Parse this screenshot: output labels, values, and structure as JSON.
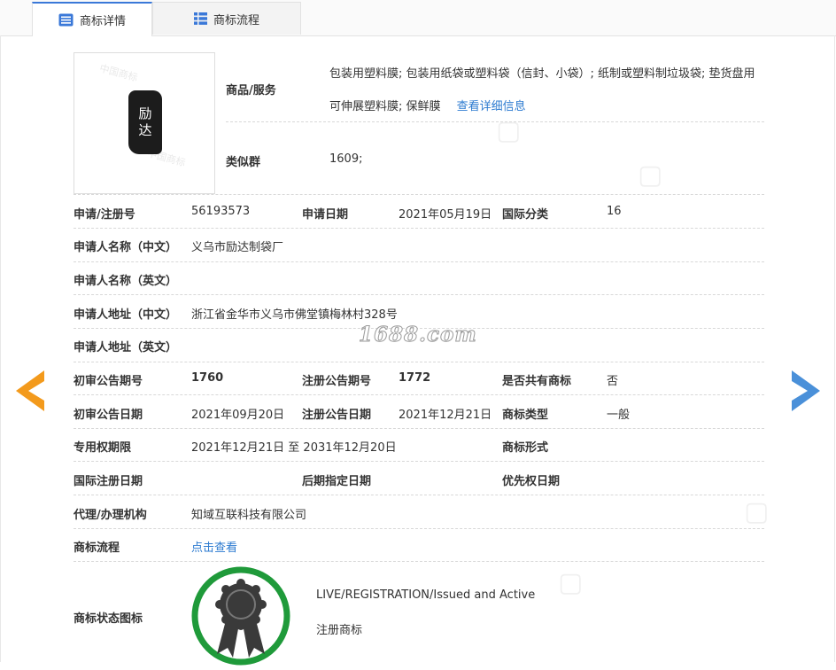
{
  "tabs": [
    {
      "label": "商标详情",
      "active": true
    },
    {
      "label": "商标流程",
      "active": false
    }
  ],
  "logo": {
    "chars": [
      "励",
      "达"
    ]
  },
  "goods": {
    "label": "商品/服务",
    "line1": "包装用塑料膜; 包装用纸袋或塑料袋（信封、小袋）; 纸制或塑料制垃圾袋; 垫货盘用",
    "line2": "可伸展塑料膜; 保鲜膜",
    "detail_link": "查看详细信息"
  },
  "similar": {
    "label": "类似群",
    "value": "1609;"
  },
  "fields": {
    "reg_no_label": "申请/注册号",
    "reg_no": "56193573",
    "apply_date_label": "申请日期",
    "apply_date": "2021年05月19日",
    "intl_class_label": "国际分类",
    "intl_class": "16",
    "applicant_cn_label": "申请人名称（中文）",
    "applicant_cn": "义乌市励达制袋厂",
    "applicant_en_label": "申请人名称（英文）",
    "applicant_en": "",
    "address_cn_label": "申请人地址（中文）",
    "address_cn": "浙江省金华市义乌市佛堂镇梅林村328号",
    "address_en_label": "申请人地址（英文）",
    "address_en": "",
    "prelim_no_label": "初审公告期号",
    "prelim_no": "1760",
    "reg_pub_no_label": "注册公告期号",
    "reg_pub_no": "1772",
    "shared_label": "是否共有商标",
    "shared": "否",
    "prelim_date_label": "初审公告日期",
    "prelim_date": "2021年09月20日",
    "reg_pub_date_label": "注册公告日期",
    "reg_pub_date": "2021年12月21日",
    "mark_type_label": "商标类型",
    "mark_type": "一般",
    "exclusive_label": "专用权期限",
    "exclusive": "2021年12月21日 至 2031年12月20日",
    "mark_form_label": "商标形式",
    "mark_form": "",
    "intl_reg_date_label": "国际注册日期",
    "intl_reg_date": "",
    "later_date_label": "后期指定日期",
    "later_date": "",
    "priority_label": "优先权日期",
    "priority": "",
    "agent_label": "代理/办理机构",
    "agent": "知域互联科技有限公司",
    "flow_label": "商标流程",
    "flow_link": "点击查看",
    "status_label": "商标状态图标",
    "status_en": "LIVE/REGISTRATION/Issued and Active",
    "status_cn": "注册商标"
  },
  "watermark": "1688.com",
  "colors": {
    "accent": "#3a78d8",
    "link": "#2d7bd0",
    "prev_arrow": "#f39a1c",
    "next_arrow": "#4a90d9",
    "badge_ring": "#1f9a3a"
  }
}
